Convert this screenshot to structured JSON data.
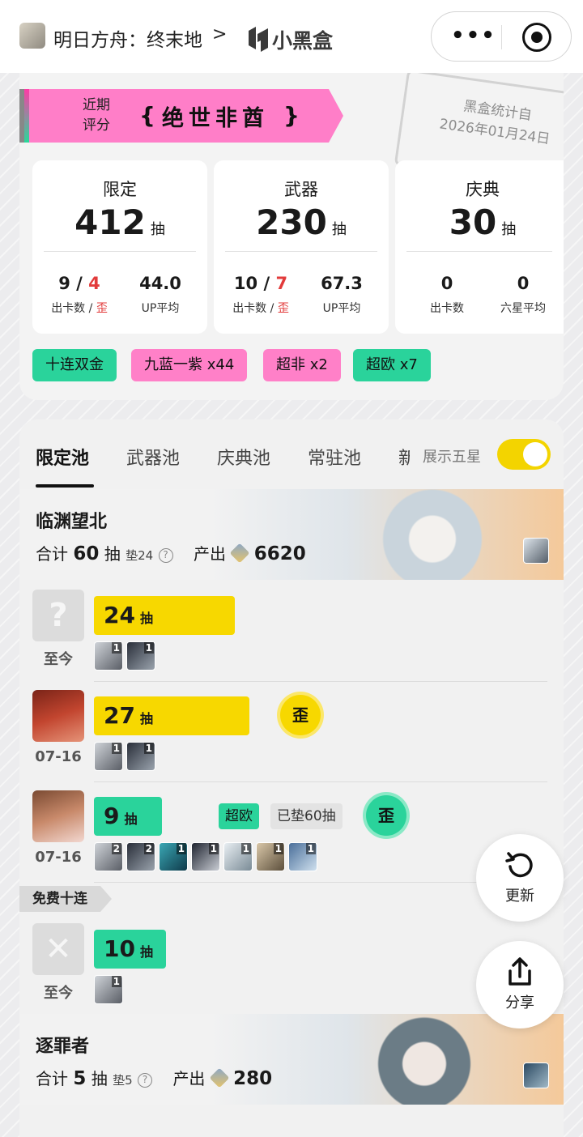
{
  "topbar": {
    "app_title": "明日方舟：终末地",
    "chevron": ">",
    "brand": "小黑盒"
  },
  "stamp": {
    "line1": "黑盒统计自",
    "line2": "2026年01月24日"
  },
  "rating": {
    "label": "近期评分",
    "value": "绝世非酋"
  },
  "stats": [
    {
      "title": "限定",
      "count": "412",
      "unit": "抽",
      "left_a": "9",
      "sep": " / ",
      "left_b": "4",
      "left_cap_a": "出卡数 / ",
      "left_cap_b": "歪",
      "right_value": "44.0",
      "right_cap": "UP平均"
    },
    {
      "title": "武器",
      "count": "230",
      "unit": "抽",
      "left_a": "10",
      "sep": " / ",
      "left_b": "7",
      "left_cap_a": "出卡数 / ",
      "left_cap_b": "歪",
      "right_value": "67.3",
      "right_cap": "UP平均"
    },
    {
      "title": "庆典",
      "count": "30",
      "unit": "抽",
      "left_a": "0",
      "left_cap_a": "出卡数",
      "right_value": "0",
      "right_cap": "六星平均"
    }
  ],
  "tags": [
    "十连双金",
    "九蓝一紫 x44",
    "超非 x2",
    "超欧 x7"
  ],
  "tabs": [
    "限定池",
    "武器池",
    "庆典池",
    "常驻池",
    "新"
  ],
  "toggle": {
    "label": "展示五星",
    "on": true
  },
  "pools": [
    {
      "name": "临渊望北",
      "total_prefix": "合计",
      "total": "60",
      "unit": "抽",
      "pity": "垫24",
      "output_label": "产出",
      "output": "6620"
    },
    {
      "name": "逐罪者",
      "total_prefix": "合计",
      "total": "5",
      "unit": "抽",
      "pity": "垫5",
      "output_label": "产出",
      "output": "280"
    }
  ],
  "records": [
    {
      "date": "至今",
      "pulls": "24",
      "unit": "抽",
      "bar_fill": 0.8,
      "color": "yellow",
      "wai": "",
      "chars": [
        "1",
        "1"
      ]
    },
    {
      "date": "07-16",
      "pulls": "27",
      "unit": "抽",
      "bar_fill": 0.9,
      "color": "yellow",
      "wai": "歪",
      "chars": [
        "1",
        "1"
      ]
    },
    {
      "date": "07-16",
      "pulls": "9",
      "unit": "抽",
      "bar_fill": 0.3,
      "color": "green",
      "badge": "超欧",
      "badge2": "已垫60抽",
      "wai": "歪",
      "chars": [
        "2",
        "2",
        "1",
        "1",
        "1",
        "1",
        "1"
      ]
    },
    {
      "date": "至今",
      "pulls": "10",
      "unit": "抽",
      "bar_fill": 0.33,
      "color": "green",
      "wai": "",
      "chars": [
        "1"
      ]
    }
  ],
  "free_section": "免费十连",
  "fabs": {
    "refresh": "更新",
    "share": "分享"
  }
}
